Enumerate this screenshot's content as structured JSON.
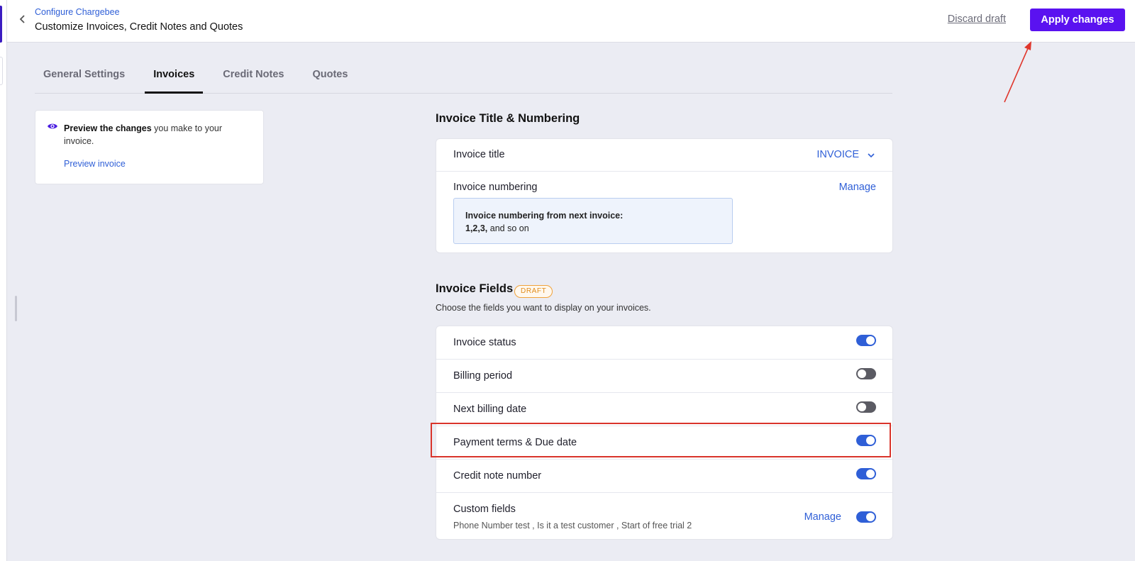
{
  "header": {
    "breadcrumb": "Configure Chargebee",
    "title": "Customize Invoices, Credit Notes and Quotes",
    "discard_label": "Discard draft",
    "apply_label": "Apply changes",
    "apply_color": "#5a12f0"
  },
  "tabs": [
    {
      "label": "General Settings",
      "active": false
    },
    {
      "label": "Invoices",
      "active": true
    },
    {
      "label": "Credit Notes",
      "active": false
    },
    {
      "label": "Quotes",
      "active": false
    }
  ],
  "preview": {
    "icon": "eye-icon",
    "bold_text": "Preview the changes",
    "rest_text": " you make to your invoice.",
    "link_label": "Preview invoice"
  },
  "title_numbering": {
    "heading": "Invoice Title & Numbering",
    "invoice_title_label": "Invoice title",
    "invoice_title_value": "INVOICE",
    "numbering_label": "Invoice numbering",
    "manage_label": "Manage",
    "info_line1": "Invoice numbering from next invoice:",
    "info_seq": "1,2,3,",
    "info_rest": " and so on"
  },
  "fields": {
    "heading": "Invoice Fields",
    "badge": "DRAFT",
    "subtitle": "Choose the fields you want to display on your invoices.",
    "rows": [
      {
        "label": "Invoice status",
        "enabled": true
      },
      {
        "label": "Billing period",
        "enabled": false
      },
      {
        "label": "Next billing date",
        "enabled": false
      },
      {
        "label": "Payment terms & Due date",
        "enabled": true,
        "highlighted": true
      },
      {
        "label": "Credit note number",
        "enabled": true
      },
      {
        "label": "Custom fields",
        "enabled": true,
        "manage_label": "Manage",
        "sub": "Phone Number test , Is it a test customer , Start of free trial 2"
      }
    ]
  },
  "colors": {
    "accent_blue": "#2f5fd7",
    "toggle_off": "#5b5b63",
    "highlight_red": "#d9342b",
    "badge_orange": "#e08b1a"
  }
}
